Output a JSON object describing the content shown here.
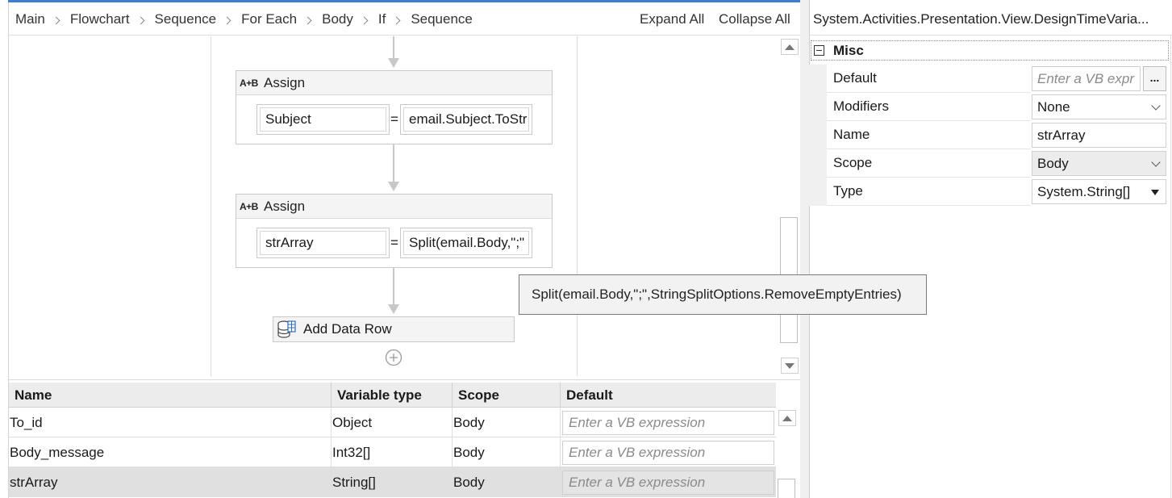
{
  "breadcrumb": [
    "Main",
    "Flowchart",
    "Sequence",
    "For Each",
    "Body",
    "If",
    "Sequence"
  ],
  "toolbar": {
    "expand_all": "Expand All",
    "collapse_all": "Collapse All"
  },
  "canvas": {
    "assign1": {
      "icon": "A+B",
      "title": "Assign",
      "to": "Subject",
      "value": "email.Subject.ToStr"
    },
    "assign2": {
      "icon": "A+B",
      "title": "Assign",
      "to": "strArray",
      "value": "Split(email.Body,\";\""
    },
    "add_data_row": {
      "icon": "database-icon",
      "title": "Add Data Row"
    },
    "equals": "="
  },
  "tooltip": "Split(email.Body,\";\",StringSplitOptions.RemoveEmptyEntries)",
  "variables": {
    "columns": [
      "Name",
      "Variable type",
      "Scope",
      "Default"
    ],
    "rows": [
      {
        "name": "To_id",
        "type": "Object",
        "scope": "Body",
        "default_placeholder": "Enter a VB expression"
      },
      {
        "name": "Body_message",
        "type": "Int32[]",
        "scope": "Body",
        "default_placeholder": "Enter a VB expression"
      },
      {
        "name": "strArray",
        "type": "String[]",
        "scope": "Body",
        "default_placeholder": "Enter a VB expression",
        "selected": true
      }
    ]
  },
  "properties": {
    "title": "System.Activities.Presentation.View.DesignTimeVaria...",
    "category": "Misc",
    "default_label": "Default",
    "default_placeholder": "Enter a VB expr",
    "ellipsis": "...",
    "modifiers_label": "Modifiers",
    "modifiers_value": "None",
    "name_label": "Name",
    "name_value": "strArray",
    "scope_label": "Scope",
    "scope_value": "Body",
    "type_label": "Type",
    "type_value": "System.String[]"
  },
  "colors": {
    "accent": "#3c7fd0",
    "header_bg": "#ececec",
    "selected_row": "#e0e0e0"
  }
}
